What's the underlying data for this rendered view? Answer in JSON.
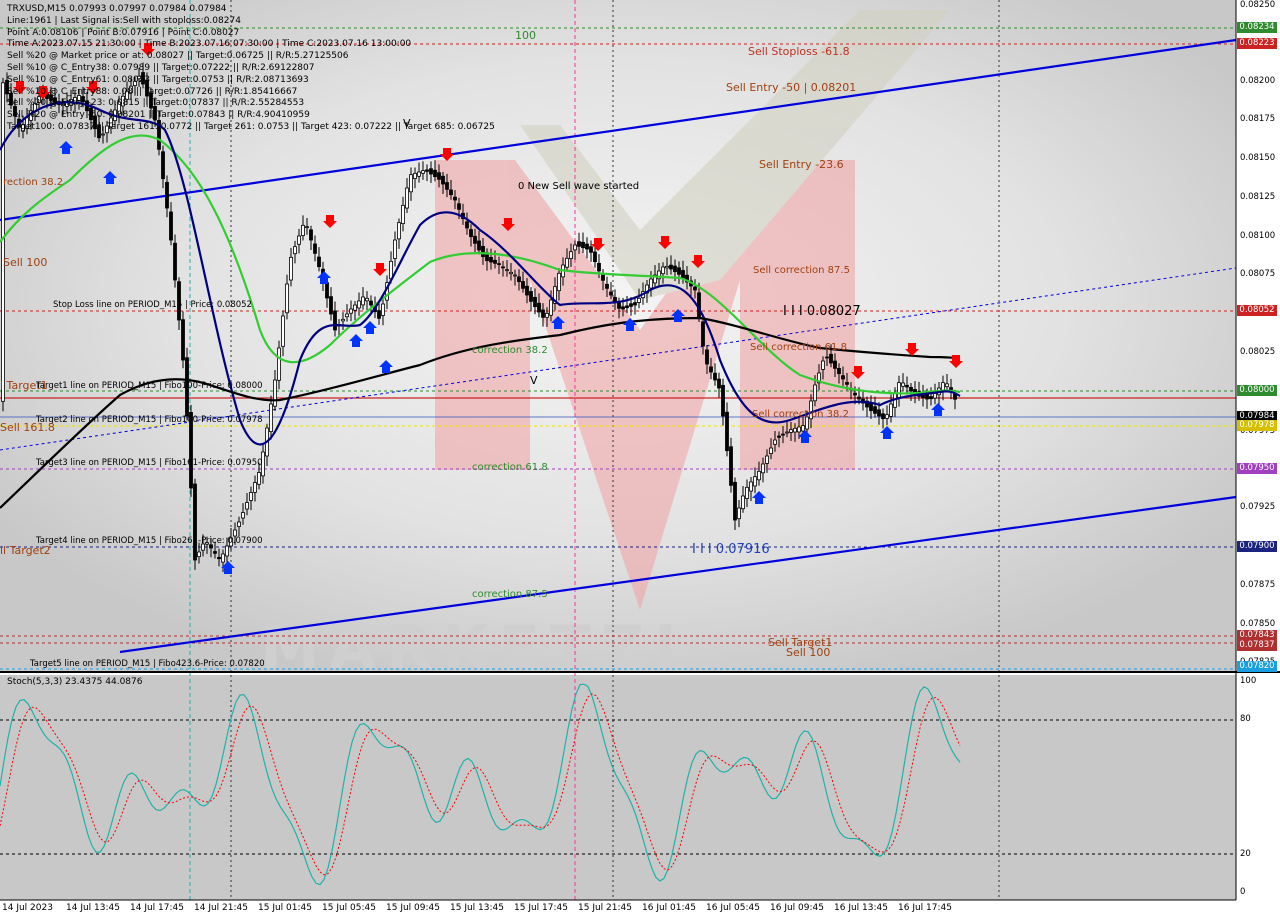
{
  "symbol_header": "TRXUSD,M15  0.07993 0.07997 0.07984 0.07984",
  "info_lines": [
    "Line:1961 | Last Signal is:Sell with stoploss:0.08274",
    "Point A:0.08106 | Point B:0.07916 | Point C:0.08027",
    "Time A:2023.07.15 21:30:00 | Time B:2023.07.16 07:30:00 | Time C:2023.07.16 13:00:00",
    "Sell %20 @ Market price or at: 0.08027 || Target:0.06725 || R/R:5.27125506",
    "Sell %10 @ C_Entry38: 0.07989 || Target:0.07222 || R/R:2.69122807",
    "Sell %10 @ C_Entry61: 0.08023 || Target:0.0753 || R/R:2.08713693",
    "Sell %10 @ C_Entry88: 0.08 || Target:0.07726 || R/R:1.85416667",
    "Sell %20 @ Entry -23: 0.0815 || Target:0.07837 || R/R:2.55284553",
    "Sell %20 @ Entry -50: 0.08201 || Target:0.07843 || R/R:4.90410959",
    "Target100: 0.07837 || Target 161: 0.0772 || Target 261: 0.0753 || Target 423: 0.07222 || Target 685: 0.06725"
  ],
  "annotations": {
    "level_100": "100",
    "sell_stoploss": "Sell Stoploss -61.8",
    "sell_entry_50": "Sell Entry -50 | 0.08201",
    "sell_entry_23": "Sell Entry -23.6",
    "correction_38_left": "rection 38.2",
    "sell_100_left": "Sell 100",
    "new_sell_wave": "0 New Sell wave started",
    "sell_correction_875": "Sell correction 87.5",
    "stop_loss_line": "Stop Loss line on PERIOD_M15 | Price: 0.08052",
    "point_c_label": "I I I 0.08027",
    "sell_correction_618": "Sell correction 61.8",
    "correction_382_mid": "correction 38.2",
    "target1_left": "l Target1",
    "target1_line": "Target1 line on PERIOD_M15 | Fibo100-Price: 0.08000",
    "target2_line": "Target2 line on PERIOD_M15 | Fibo100-Price: 0.07978",
    "sell_1618_left": "Sell 161.8",
    "sell_correction_382": "Sell correction 38.2",
    "target3_line": "Target3 line on PERIOD_M15 | Fibo161-Price: 0.07950",
    "correction_618_mid": "correction 61.8",
    "target4_line": "Target4 line on PERIOD_M15 | Fibo261-Price: 0.07900",
    "target2_left": "ll Target2",
    "point_b_label": "I I I 0.07916",
    "correction_875_mid": "correction 87.5",
    "sell_target1": "Sell Target1",
    "sell_100_bottom": "Sell 100",
    "target5_line": "Target5 line on PERIOD_M15 | Fibo423.6-Price: 0.07820",
    "wave_v_top": "V",
    "wave_v_mid": "V"
  },
  "price_axis": [
    "0.08250",
    "0.08200",
    "0.08175",
    "0.08150",
    "0.08125",
    "0.08100",
    "0.08075",
    "0.08025",
    "0.07975",
    "0.07925",
    "0.07875",
    "0.07850",
    "0.07825"
  ],
  "price_tags": [
    {
      "text": "0.08234",
      "color": "#2e8b2e"
    },
    {
      "text": "0.08223",
      "color": "#cc2222"
    },
    {
      "text": "0.08052",
      "color": "#cc2222"
    },
    {
      "text": "0.08000",
      "color": "#2e8b2e"
    },
    {
      "text": "0.07984",
      "color": "#000000"
    },
    {
      "text": "0.07978",
      "color": "#d4c000"
    },
    {
      "text": "0.07950",
      "color": "#a040c0"
    },
    {
      "text": "0.07900",
      "color": "#1a237e"
    },
    {
      "text": "0.07843",
      "color": "#b03030"
    },
    {
      "text": "0.07837",
      "color": "#b03030"
    },
    {
      "text": "0.07820",
      "color": "#1aa0e0"
    }
  ],
  "time_axis": [
    "14 Jul 2023",
    "14 Jul 13:45",
    "14 Jul 17:45",
    "14 Jul 21:45",
    "15 Jul 01:45",
    "15 Jul 05:45",
    "15 Jul 09:45",
    "15 Jul 13:45",
    "15 Jul 17:45",
    "15 Jul 21:45",
    "16 Jul 01:45",
    "16 Jul 05:45",
    "16 Jul 09:45",
    "16 Jul 13:45",
    "16 Jul 17:45"
  ],
  "stochastic": {
    "title": "Stoch(5,3,3) 23.4375 44.0876",
    "levels": [
      "100",
      "80",
      "20",
      "0"
    ]
  },
  "colors": {
    "background": "#ffffff",
    "channel": "#0000dd",
    "ma_green": "#33cc33",
    "ma_navy": "#000080",
    "ma_black": "#000000",
    "sell_arrow": "#ff0000",
    "buy_arrow": "#0033ff",
    "stoch_main": "#20b2aa",
    "stoch_signal": "#ff0000"
  }
}
